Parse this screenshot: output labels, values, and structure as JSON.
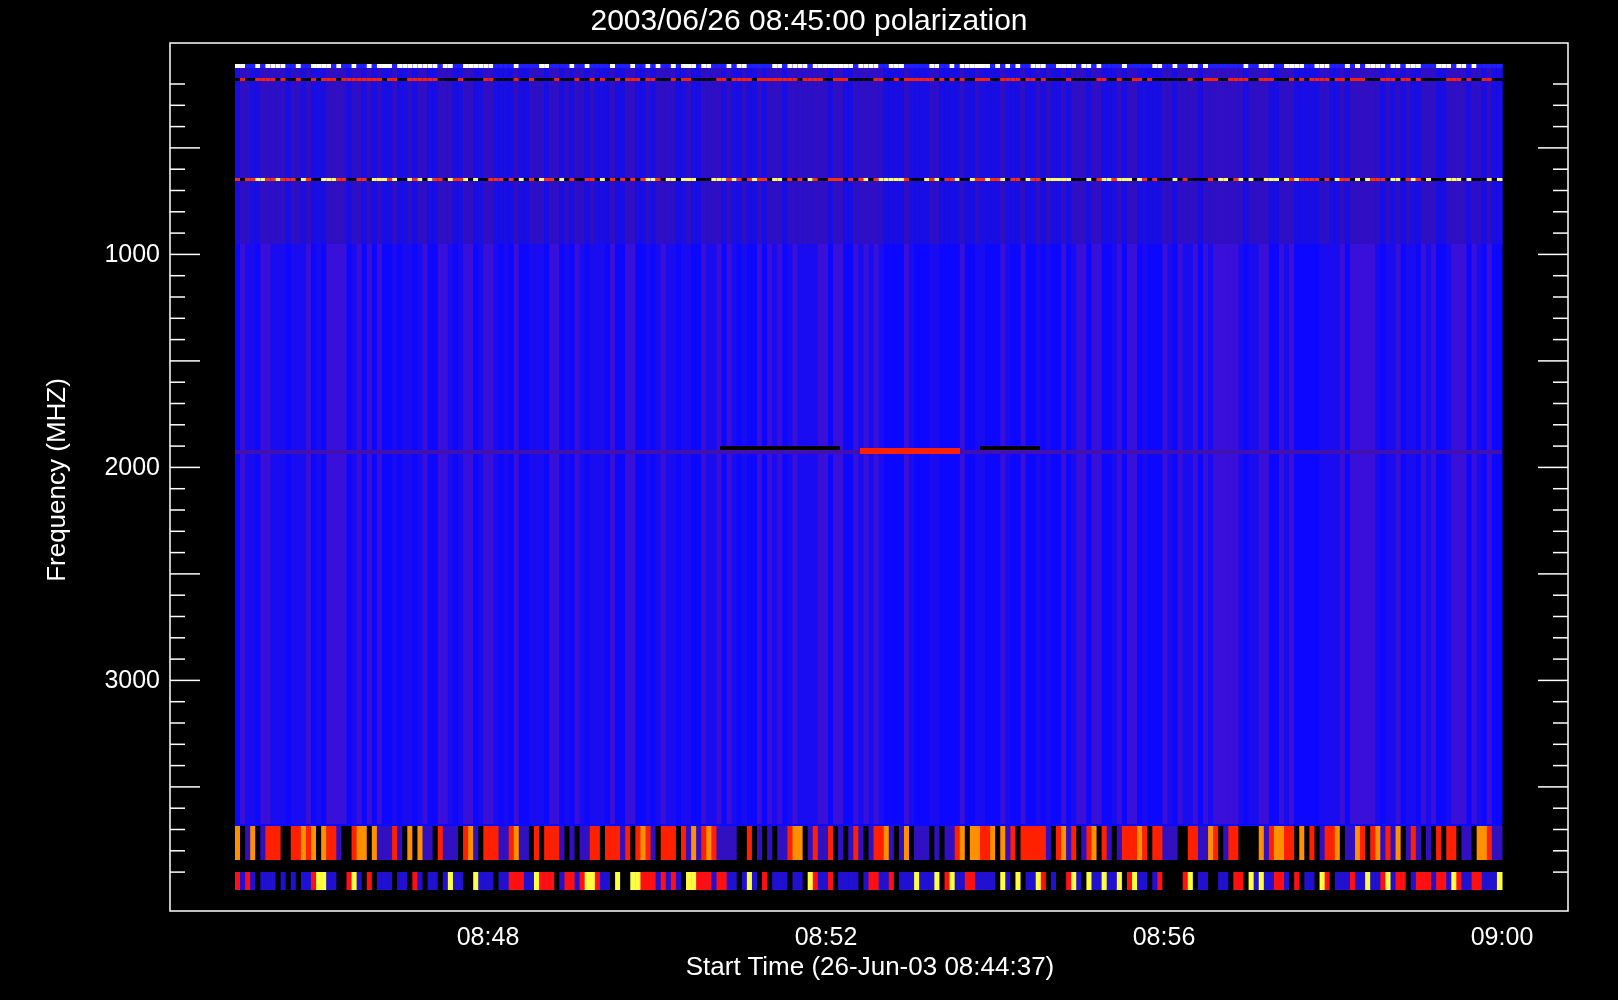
{
  "plot": {
    "title": "2003/06/26 08:45:00 polarization",
    "xlabel": "Start Time (26-Jun-03 08:44:37)",
    "ylabel": "Frequency (MHZ)",
    "xtick_labels": [
      "08:48",
      "08:52",
      "08:56",
      "09:00"
    ],
    "ytick_labels": [
      "1000",
      "2000",
      "3000"
    ]
  }
}
